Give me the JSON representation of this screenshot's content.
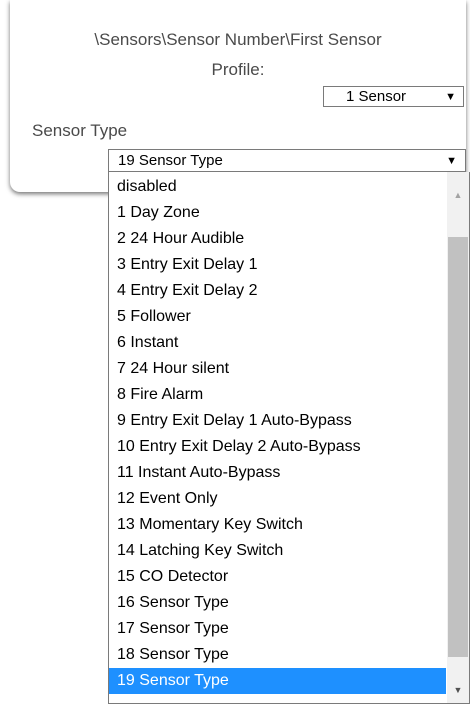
{
  "header": {
    "path": "\\Sensors\\Sensor Number\\First Sensor",
    "profile_label": "Profile:"
  },
  "profile_select": {
    "value": "1 Sensor"
  },
  "sensor_type": {
    "label": "Sensor Type",
    "selected": "19 Sensor Type",
    "options": [
      "disabled",
      "1 Day Zone",
      "2 24 Hour Audible",
      "3 Entry Exit Delay 1",
      "4 Entry Exit Delay 2",
      "5 Follower",
      "6 Instant",
      "7 24 Hour silent",
      "8 Fire Alarm",
      "9 Entry Exit Delay 1 Auto-Bypass",
      "10 Entry Exit Delay 2 Auto-Bypass",
      "11 Instant Auto-Bypass",
      "12 Event Only",
      "13 Momentary Key Switch",
      "14 Latching Key Switch",
      "15 CO Detector",
      "16 Sensor Type",
      "17 Sensor Type",
      "18 Sensor Type",
      "19 Sensor Type"
    ]
  },
  "icons": {
    "dropdown_arrow": "triangle-down",
    "scroll_up": "triangle-up",
    "scroll_down": "triangle-down"
  },
  "colors": {
    "selection": "#1e90ff",
    "label_text": "#4a4a4a",
    "scroll_thumb": "#c1c1c1"
  }
}
